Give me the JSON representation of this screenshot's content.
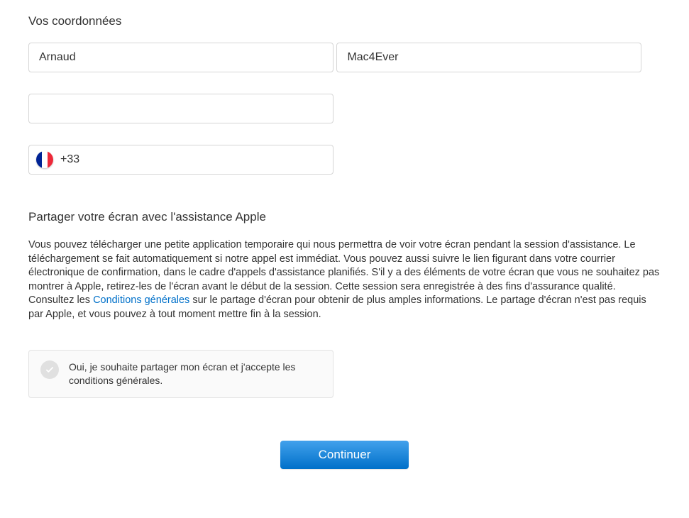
{
  "contact": {
    "title": "Vos coordonnées",
    "first_name": "Arnaud",
    "last_name": "Mac4Ever",
    "email": "",
    "phone_prefix": "+33",
    "phone_value": "",
    "country_flag": "fr"
  },
  "screenshare": {
    "title": "Partager votre écran avec l'assistance Apple",
    "desc_part1": "Vous pouvez télécharger une petite application temporaire qui nous permettra de voir votre écran pendant la session d'assistance. Le téléchargement se fait automatiquement si notre appel est immédiat. Vous pouvez aussi suivre le lien figurant dans votre courrier électronique de confirmation, dans le cadre d'appels d'assistance planifiés. S'il y a des éléments de votre écran que vous ne souhaitez pas montrer à Apple, retirez-les de l'écran avant le début de la session. Cette session sera enregistrée à des fins d'assurance qualité. Consultez les ",
    "terms_link": "Conditions générales",
    "desc_part2": " sur le partage d'écran pour obtenir de plus amples informations. Le partage d'écran n'est pas requis par Apple, et vous pouvez à tout moment mettre fin à la session.",
    "consent_label": "Oui, je souhaite partager mon écran et j'accepte les conditions générales."
  },
  "actions": {
    "continue_label": "Continuer"
  }
}
